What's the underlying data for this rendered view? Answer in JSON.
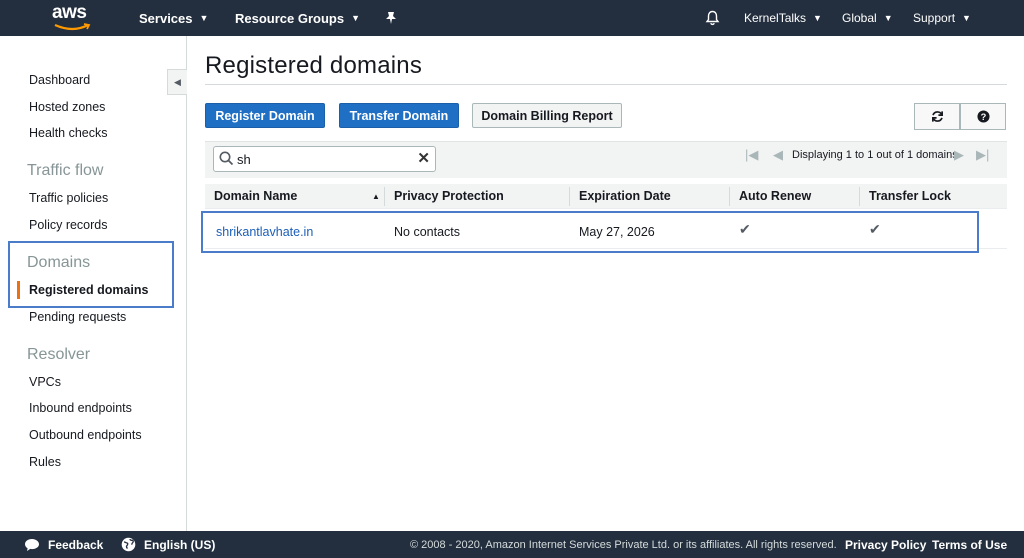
{
  "topnav": {
    "logo": "aws",
    "services": "Services",
    "resource_groups": "Resource Groups",
    "pin_icon": "pin-icon",
    "bell_icon": "bell-icon",
    "account": "KernelTalks",
    "region": "Global",
    "support": "Support"
  },
  "sidebar": {
    "items": [
      {
        "label": "Dashboard"
      },
      {
        "label": "Hosted zones"
      },
      {
        "label": "Health checks"
      },
      {
        "label": "Traffic flow",
        "type": "heading"
      },
      {
        "label": "Traffic policies"
      },
      {
        "label": "Policy records"
      },
      {
        "label": "Domains",
        "type": "heading"
      },
      {
        "label": "Registered domains",
        "active": true
      },
      {
        "label": "Pending requests"
      },
      {
        "label": "Resolver",
        "type": "heading"
      },
      {
        "label": "VPCs"
      },
      {
        "label": "Inbound endpoints"
      },
      {
        "label": "Outbound endpoints"
      },
      {
        "label": "Rules"
      }
    ]
  },
  "main": {
    "title": "Registered domains",
    "buttons": {
      "register": "Register Domain",
      "transfer": "Transfer Domain",
      "billing": "Domain Billing Report",
      "refresh_icon": "refresh-icon",
      "help_icon": "help-icon"
    },
    "search": {
      "value": "sh"
    },
    "pager": {
      "text": "Displaying 1 to 1 out of 1 domains"
    },
    "table": {
      "columns": [
        "Domain Name",
        "Privacy Protection",
        "Expiration Date",
        "Auto Renew",
        "Transfer Lock"
      ],
      "rows": [
        {
          "domain": "shrikantlavhate.in",
          "privacy": "No contacts",
          "expiration": "May 27, 2026",
          "auto_renew": true,
          "transfer_lock": true
        }
      ]
    }
  },
  "footer": {
    "feedback": "Feedback",
    "language": "English (US)",
    "copyright": "© 2008 - 2020, Amazon Internet Services Private Ltd. or its affiliates. All rights reserved.",
    "privacy": "Privacy Policy",
    "terms": "Terms of Use"
  },
  "colors": {
    "nav_bg": "#232f3e",
    "primary": "#1f6fc5",
    "active_marker": "#ec7211",
    "highlight_box": "#4a7cc9",
    "link": "#1c5fb8"
  }
}
